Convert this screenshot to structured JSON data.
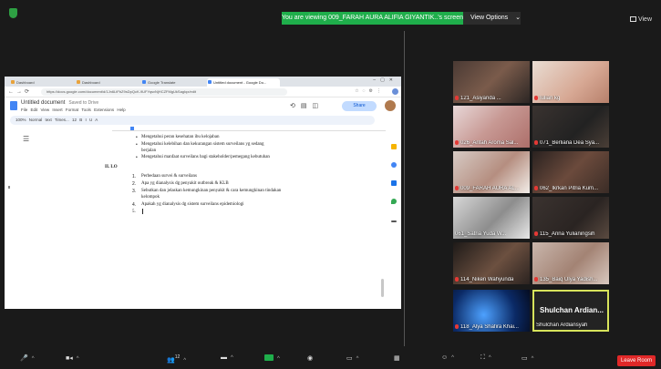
{
  "banner": {
    "text": "You are viewing 009_FARAH AURA ALIFIA GIYANTIK..'s screen",
    "view_options": "View Options",
    "view": "View"
  },
  "browser": {
    "tabs": [
      {
        "label": "Dashboard"
      },
      {
        "label": "Dashboard"
      },
      {
        "label": "Google Translate"
      },
      {
        "label": "Untitled document - Google Do..."
      }
    ],
    "url": "https://docs.google.com/document/d/1Jn6LtFbZ9sDpQcK-9UFYqsvNjHCZFMgUkSagIqx/edit"
  },
  "doc": {
    "title": "Untitled document",
    "saved": "Saved to Drive",
    "menu": "File  Edit  View  Insert  Format  Tools  Extensions  Help",
    "toolbar": "100%   Normal text   Times...   12   B  I  U  A",
    "share": "Share",
    "lines": [
      "Mengetahui peran kesehatan ibu kelojaban",
      "Mengetahui kelebihan dan kekurangan sistem surveilans yg sedang",
      "berjalan",
      "Mengetahui manfaat surveilans bagi stakeholder/pemegang kebutuhan",
      "II.  LO",
      "Perbedaan survei & surveilans",
      "Apa yg dianalysis dg penyakit outbreak & KLB",
      "Sebutkan dan jelaskan kemungkinan penyakit & cara kemungkinan tindakan",
      "kelompok",
      "Apakah yg dianalysis dg sistem surveilans epidemiologi",
      "5."
    ]
  },
  "participants": [
    {
      "name": "121_Asiyanda ..."
    },
    {
      "name": "Iulian kg"
    },
    {
      "name": "026_Anfah Aroma Sal..."
    },
    {
      "name": "071_Berliana Dea Sya..."
    },
    {
      "name": "009_FARAH AURA AL..."
    },
    {
      "name": "062_Ikrkan Pitria Kum..."
    },
    {
      "name": "061_Satria Yuda W..."
    },
    {
      "name": "115_Arina Yulianingsih"
    },
    {
      "name": "114_Niken Wahyunda"
    },
    {
      "name": "135_Baiq Ulya Yadish..."
    },
    {
      "name": "118_Alya Shafira Khai..."
    },
    {
      "name": "Shulchan Ardiansyah",
      "big": "Shulchan Ardian..."
    }
  ],
  "bottombar": {
    "participants_count": "12",
    "leave": "Leave Room"
  }
}
